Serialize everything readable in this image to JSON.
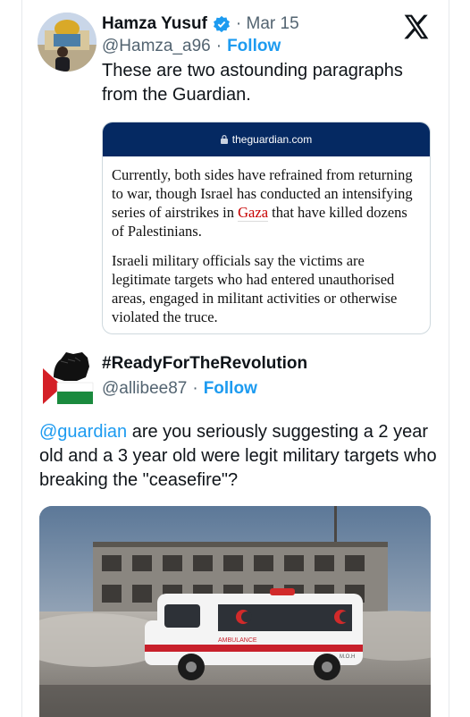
{
  "tweet": {
    "author_name": "Hamza Yusuf",
    "date": "· Mar 15",
    "handle": "@Hamza_a96",
    "separator": "·",
    "follow_label": "Follow",
    "text": "These are two astounding paragraphs from the Guardian.",
    "platform_icon": "x-logo-icon",
    "verified_icon": "verified-badge-icon"
  },
  "card": {
    "domain": "theguardian.com",
    "para1_before": "Currently, both sides have refrained from returning to war, though Israel has conducted an intensifying series of airstrikes in ",
    "para1_link": "Gaza",
    "para1_after": " that have killed dozens of Palestinians.",
    "para2": "Israeli military officials say the victims are legitimate targets who had entered unauthorised areas, engaged in militant activities or otherwise violated the truce.",
    "bar_color": "#052962",
    "link_color": "#c70000"
  },
  "quoted": {
    "author_name": "#ReadyForTheRevolution",
    "handle": "@allibee87",
    "separator": "·",
    "follow_label": "Follow",
    "mention": "@guardian",
    "text": " are you seriously suggesting a 2 year old and a 3 year old were legit military targets who breaking the \"ceasefire\"?",
    "photo_labels": {
      "ambulance": "AMBULANCE",
      "moh": "M.O.H"
    }
  },
  "colors": {
    "accent": "#1d9bf0",
    "muted": "#536471",
    "text": "#0f1419"
  }
}
